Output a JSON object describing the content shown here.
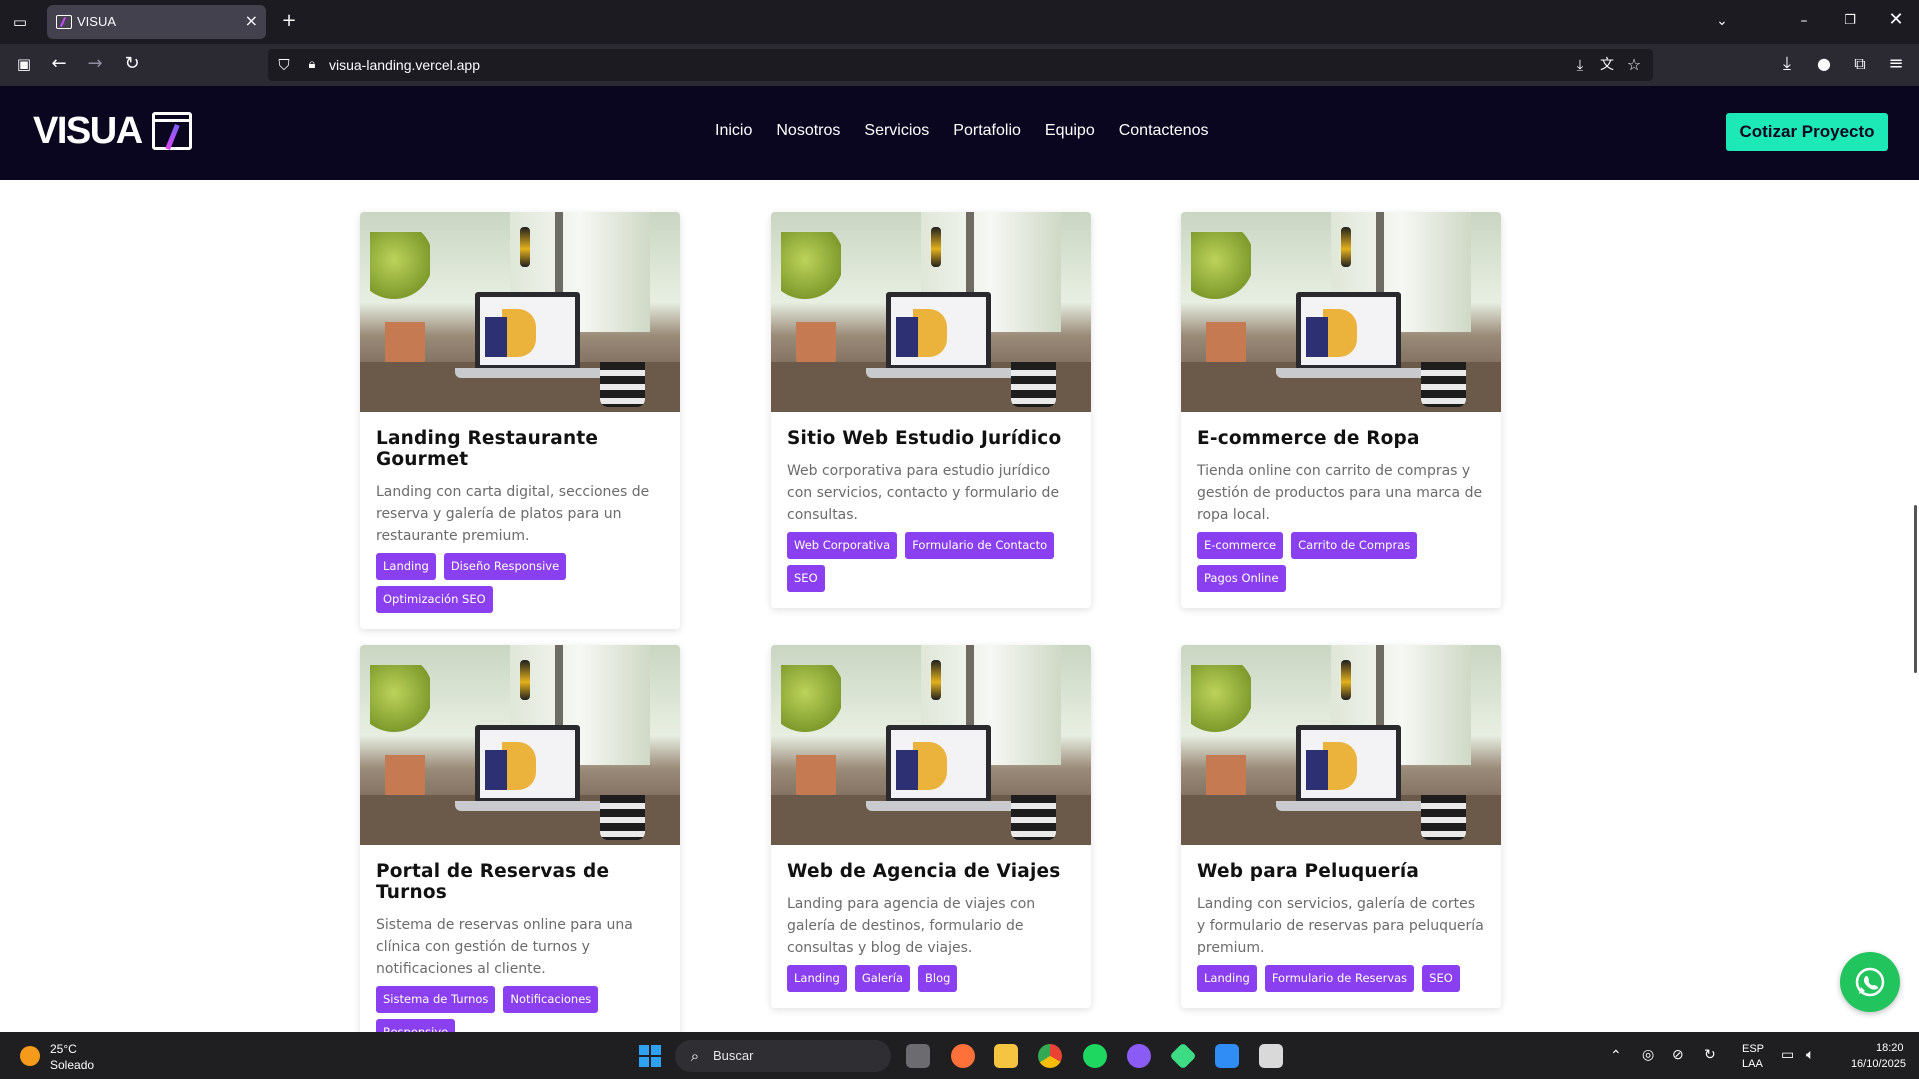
{
  "browser": {
    "tab_title": "VISUA",
    "url": "visua-landing.vercel.app"
  },
  "site": {
    "logo": "VISUA",
    "nav": [
      "Inicio",
      "Nosotros",
      "Servicios",
      "Portafolio",
      "Equipo",
      "Contactenos"
    ],
    "cta": "Cotizar Proyecto"
  },
  "projects": [
    {
      "title": "Landing Restaurante Gourmet",
      "description": "Landing con carta digital, secciones de reserva y galería de platos para un restaurante premium.",
      "tags": [
        "Landing",
        "Diseño Responsive",
        "Optimización SEO"
      ]
    },
    {
      "title": "Sitio Web Estudio Jurídico",
      "description": "Web corporativa para estudio jurídico con servicios, contacto y formulario de consultas.",
      "tags": [
        "Web Corporativa",
        "Formulario de Contacto",
        "SEO"
      ]
    },
    {
      "title": "E-commerce de Ropa",
      "description": "Tienda online con carrito de compras y gestión de productos para una marca de ropa local.",
      "tags": [
        "E-commerce",
        "Carrito de Compras",
        "Pagos Online"
      ]
    },
    {
      "title": "Portal de Reservas de Turnos",
      "description": "Sistema de reservas online para una clínica con gestión de turnos y notificaciones al cliente.",
      "tags": [
        "Sistema de Turnos",
        "Notificaciones",
        "Responsive"
      ]
    },
    {
      "title": "Web de Agencia de Viajes",
      "description": "Landing para agencia de viajes con galería de destinos, formulario de consultas y blog de viajes.",
      "tags": [
        "Landing",
        "Galería",
        "Blog"
      ]
    },
    {
      "title": "Web para Peluquería",
      "description": "Landing con servicios, galería de cortes y formulario de reservas para peluquería premium.",
      "tags": [
        "Landing",
        "Formulario de Reservas",
        "SEO"
      ]
    }
  ],
  "taskbar": {
    "weather_temp": "25°C",
    "weather_desc": "Soleado",
    "search_placeholder": "Buscar",
    "lang_top": "ESP",
    "lang_bottom": "LAA",
    "time": "18:20",
    "date": "16/10/2025"
  },
  "colors": {
    "header_bg": "#0a0620",
    "cta_bg": "#1de9b6",
    "tag_bg": "#8a3ff0",
    "whatsapp": "#22c45e"
  }
}
